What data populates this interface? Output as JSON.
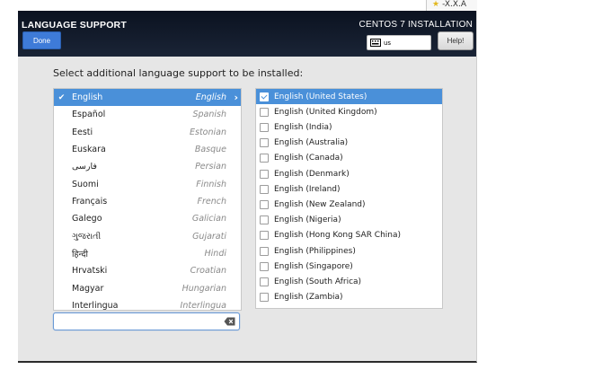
{
  "corner": {
    "star": "★",
    "text": "-X.X.A"
  },
  "header": {
    "title": "LANGUAGE SUPPORT",
    "done_label": "Done",
    "product": "CENTOS 7 INSTALLATION",
    "keyboard_layout": "us",
    "help_label": "Help!"
  },
  "instruction": "Select additional language support to be installed:",
  "languages": [
    {
      "native": "English",
      "english": "English",
      "selected": true
    },
    {
      "native": "Español",
      "english": "Spanish"
    },
    {
      "native": "Eesti",
      "english": "Estonian"
    },
    {
      "native": "Euskara",
      "english": "Basque"
    },
    {
      "native": "فارسی",
      "english": "Persian"
    },
    {
      "native": "Suomi",
      "english": "Finnish"
    },
    {
      "native": "Français",
      "english": "French"
    },
    {
      "native": "Galego",
      "english": "Galician"
    },
    {
      "native": "ગુજરાતી",
      "english": "Gujarati"
    },
    {
      "native": "हिन्दी",
      "english": "Hindi"
    },
    {
      "native": "Hrvatski",
      "english": "Croatian"
    },
    {
      "native": "Magyar",
      "english": "Hungarian"
    },
    {
      "native": "Interlingua",
      "english": "Interlingua"
    }
  ],
  "search": {
    "value": "",
    "placeholder": ""
  },
  "locales": [
    {
      "label": "English (United States)",
      "checked": true
    },
    {
      "label": "English (United Kingdom)"
    },
    {
      "label": "English (India)"
    },
    {
      "label": "English (Australia)"
    },
    {
      "label": "English (Canada)"
    },
    {
      "label": "English (Denmark)"
    },
    {
      "label": "English (Ireland)"
    },
    {
      "label": "English (New Zealand)"
    },
    {
      "label": "English (Nigeria)"
    },
    {
      "label": "English (Hong Kong SAR China)"
    },
    {
      "label": "English (Philippines)"
    },
    {
      "label": "English (Singapore)"
    },
    {
      "label": "English (South Africa)"
    },
    {
      "label": "English (Zambia)"
    }
  ],
  "colors": {
    "header": "#0b1220",
    "accent": "#4a90d9",
    "done_button": "#3e7bd8",
    "background": "#e6e6e6"
  },
  "icons": {
    "checkmark": "checkmark-icon",
    "chevron": "chevron-right-icon",
    "keyboard": "keyboard-icon",
    "clear": "clear-text-icon"
  }
}
